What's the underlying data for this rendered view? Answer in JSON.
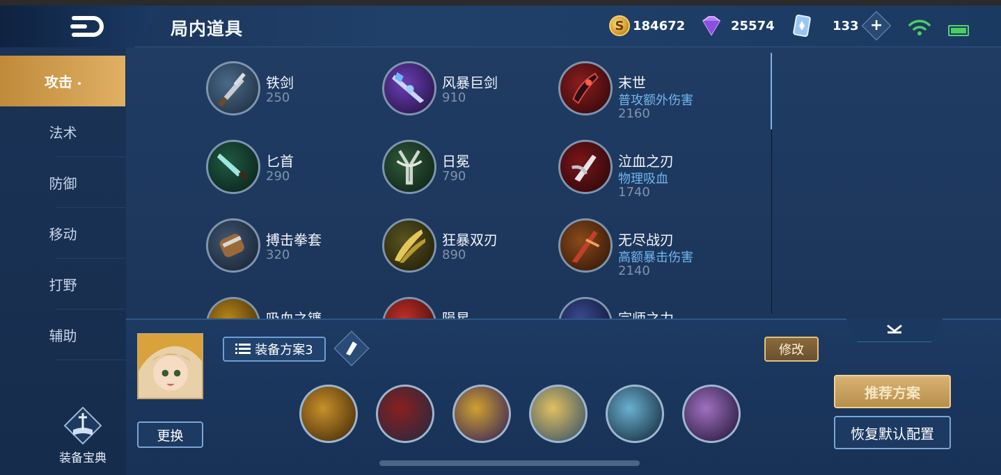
{
  "header": {
    "title": "局内道具",
    "gold": "184672",
    "gems": "25574",
    "tickets": "133"
  },
  "sidebar": {
    "tabs": [
      {
        "label": "攻击",
        "active": true
      },
      {
        "label": "法术"
      },
      {
        "label": "防御"
      },
      {
        "label": "移动"
      },
      {
        "label": "打野"
      },
      {
        "label": "辅助"
      }
    ],
    "codex_label": "装备宝典"
  },
  "items": [
    {
      "name": "铁剑",
      "price": "250",
      "icon": "iron-sword"
    },
    {
      "name": "风暴巨剑",
      "price": "910",
      "icon": "storm-sword"
    },
    {
      "name": "末世",
      "desc": "普攻额外伤害",
      "price": "2160",
      "icon": "doomsday"
    },
    {
      "name": "匕首",
      "price": "290",
      "icon": "dagger"
    },
    {
      "name": "日冕",
      "price": "790",
      "icon": "corona"
    },
    {
      "name": "泣血之刃",
      "desc": "物理吸血",
      "price": "1740",
      "icon": "bloodweeping-blade"
    },
    {
      "name": "搏击拳套",
      "price": "320",
      "icon": "boxing-glove"
    },
    {
      "name": "狂暴双刃",
      "price": "890",
      "icon": "berserk-blades"
    },
    {
      "name": "无尽战刃",
      "desc": "高额暴击伤害",
      "price": "2140",
      "icon": "infinity-blade"
    },
    {
      "name": "吸血之镰",
      "icon": "vampire-scythe"
    },
    {
      "name": "陨星",
      "icon": "meteor"
    },
    {
      "name": "宗师之力",
      "icon": "master-power"
    }
  ],
  "bottom": {
    "change_label": "更换",
    "plan_label": "装备方案3",
    "modify_label": "修改",
    "recommend_label": "推荐方案",
    "reset_label": "恢复默认配置",
    "equipped": [
      "gold-helmet",
      "red-boots",
      "gold-chalice",
      "gold-shield",
      "ice-axe",
      "skull-armor"
    ]
  },
  "colors": {
    "accent_gold": "#e0b064",
    "desc_blue": "#6fb6ee",
    "price_gray": "#7f93ac"
  }
}
